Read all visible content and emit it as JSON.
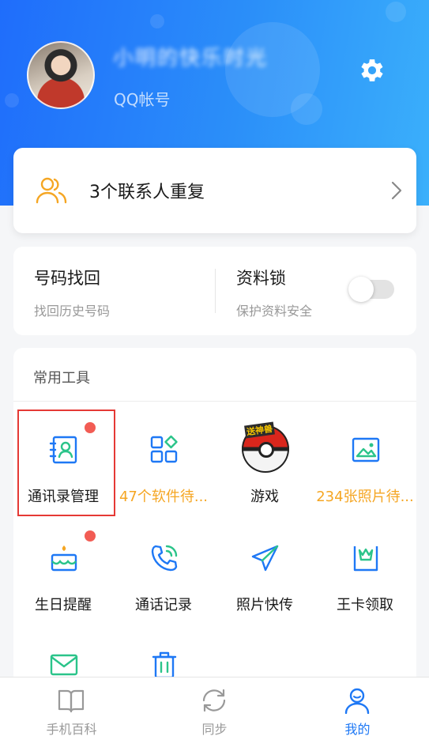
{
  "header": {
    "nickname": "小明的快乐时光",
    "account_label": "QQ帐号"
  },
  "duplicate_card": {
    "text": "3个联系人重复"
  },
  "features": {
    "number_recovery": {
      "title": "号码找回",
      "subtitle": "找回历史号码"
    },
    "data_lock": {
      "title": "资料锁",
      "subtitle": "保护资料安全",
      "enabled": false
    }
  },
  "tools": {
    "title": "常用工具",
    "items": [
      {
        "label": "通讯录管理",
        "icon": "contacts-book-icon",
        "badge": true,
        "highlighted": true
      },
      {
        "label": "47个软件待...",
        "icon": "app-grid-icon",
        "badge": false
      },
      {
        "label": "游戏",
        "icon": "pokeball-icon",
        "badge_text": "送神兽",
        "badge": false
      },
      {
        "label": "234张照片待...",
        "icon": "photo-icon",
        "badge": false
      },
      {
        "label": "生日提醒",
        "icon": "birthday-cake-icon",
        "badge": true
      },
      {
        "label": "通话记录",
        "icon": "phone-call-icon",
        "badge": false
      },
      {
        "label": "照片快传",
        "icon": "paper-plane-icon",
        "badge": false
      },
      {
        "label": "王卡领取",
        "icon": "king-card-icon",
        "badge": false
      },
      {
        "label": "",
        "icon": "mail-icon",
        "badge": false
      },
      {
        "label": "",
        "icon": "trash-icon",
        "badge": false
      }
    ]
  },
  "bottom_nav": {
    "items": [
      {
        "label": "手机百科",
        "icon": "book-icon",
        "active": false
      },
      {
        "label": "同步",
        "icon": "sync-icon",
        "active": false
      },
      {
        "label": "我的",
        "icon": "profile-icon",
        "active": true
      }
    ]
  },
  "colors": {
    "primary_blue": "#1e78f5",
    "header_gradient_start": "#1f6dfb",
    "header_gradient_end": "#3bb0fb",
    "accent_orange": "#f5a623",
    "badge_red": "#f25c54",
    "highlight_red": "#e53935"
  }
}
